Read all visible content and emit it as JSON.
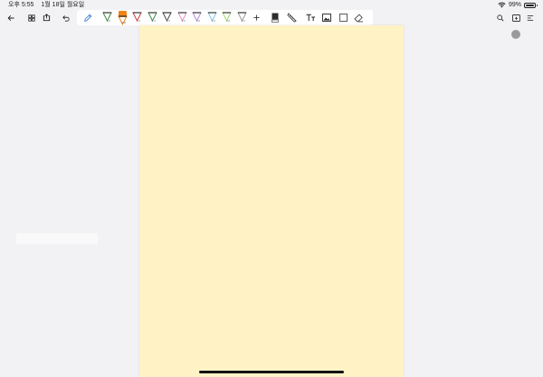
{
  "status_bar": {
    "time": "오후 5:55",
    "date": "1월 18일 월요일",
    "battery_percent": "99%",
    "battery_level": 0.99
  },
  "toolbar": {
    "left_icons": [
      "back-arrow-icon",
      "grid-icon",
      "share-icon",
      "undo-icon"
    ],
    "pens": [
      {
        "color": "#3c8a3a",
        "size": "1.0"
      },
      {
        "color": "#f08218",
        "size": "0.8",
        "selected": true
      },
      {
        "color": "#c73b3b",
        "size": "1.0"
      },
      {
        "color": "#3a8a4f",
        "size": "0.4"
      },
      {
        "color": "#4a4a4a",
        "size": "1.5"
      },
      {
        "color": "#e58fbf",
        "size": "3.0"
      },
      {
        "color": "#b88ad9",
        "size": "3.0"
      },
      {
        "color": "#7cc7e6",
        "size": "3.0"
      },
      {
        "color": "#a3d86e",
        "size": "3.0"
      },
      {
        "color": "#9a9a9a",
        "size": "3.0"
      }
    ],
    "right_icons": [
      "search-icon",
      "page-add-icon",
      "more-menu-icon"
    ]
  },
  "colors": {
    "background": "#f2f1f4",
    "page": "#fff3c6",
    "toolbar_group": "#ffffff"
  }
}
